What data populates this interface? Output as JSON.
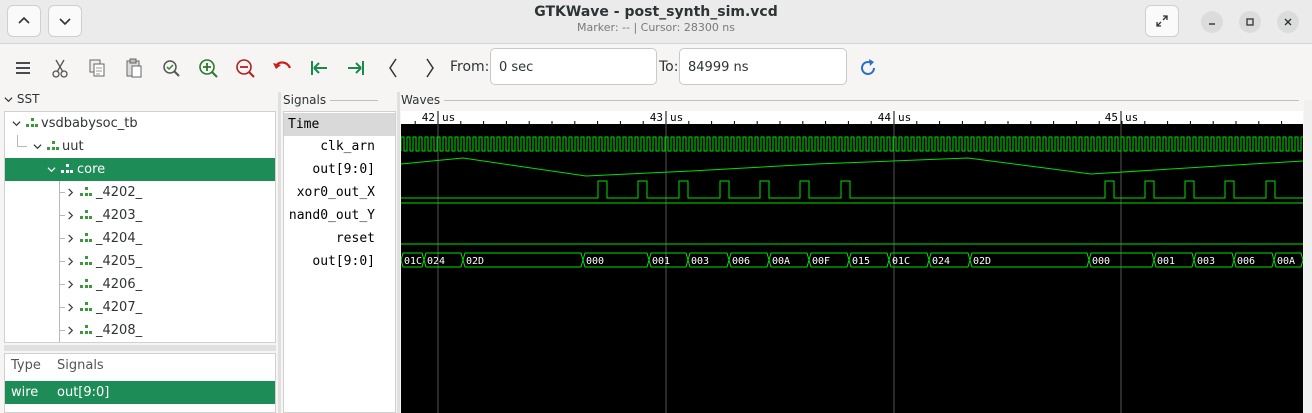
{
  "window": {
    "title": "GTKWave - post_synth_sim.vcd",
    "subtitle": "Marker: --  |  Cursor: 28300 ns"
  },
  "toolbar": {
    "from_label": "From:",
    "from_value": "0 sec",
    "to_label": "To:",
    "to_value": "84999 ns"
  },
  "sst": {
    "header": "SST",
    "tree": [
      {
        "label": "vsdbabysoc_tb",
        "level": 0,
        "expanded": true
      },
      {
        "label": "uut",
        "level": 1,
        "expanded": true
      },
      {
        "label": "core",
        "level": 2,
        "expanded": true,
        "selected": true
      },
      {
        "label": "_4202_",
        "level": 3
      },
      {
        "label": "_4203_",
        "level": 3
      },
      {
        "label": "_4204_",
        "level": 3
      },
      {
        "label": "_4205_",
        "level": 3
      },
      {
        "label": "_4206_",
        "level": 3
      },
      {
        "label": "_4207_",
        "level": 3
      },
      {
        "label": "_4208_",
        "level": 3
      }
    ],
    "list_headers": {
      "type": "Type",
      "signals": "Signals"
    },
    "list_rows": [
      {
        "type": "wire",
        "signal": "out[9:0]"
      }
    ]
  },
  "signals_pane": {
    "header": "Signals",
    "time_label": "Time",
    "names": [
      "clk_arn",
      "out[9:0]",
      "xor0_out_X",
      "nand0_out_Y",
      "reset",
      "out[9:0]"
    ]
  },
  "waves_pane": {
    "header": "Waves",
    "time_markers": [
      {
        "major": "42",
        "unit": "us"
      },
      {
        "major": "43",
        "unit": "us"
      },
      {
        "major": "44",
        "unit": "us"
      },
      {
        "major": "45",
        "unit": "us"
      }
    ],
    "bus_values": [
      "01C",
      "024",
      "02D",
      "000",
      "001",
      "003",
      "006",
      "00A",
      "00F",
      "015",
      "01C",
      "024",
      "02D",
      "000",
      "001",
      "003",
      "006",
      "00A"
    ]
  },
  "colors": {
    "wave_green": "#00e000",
    "selection": "#1e8c56",
    "wave_bg": "#000000"
  }
}
